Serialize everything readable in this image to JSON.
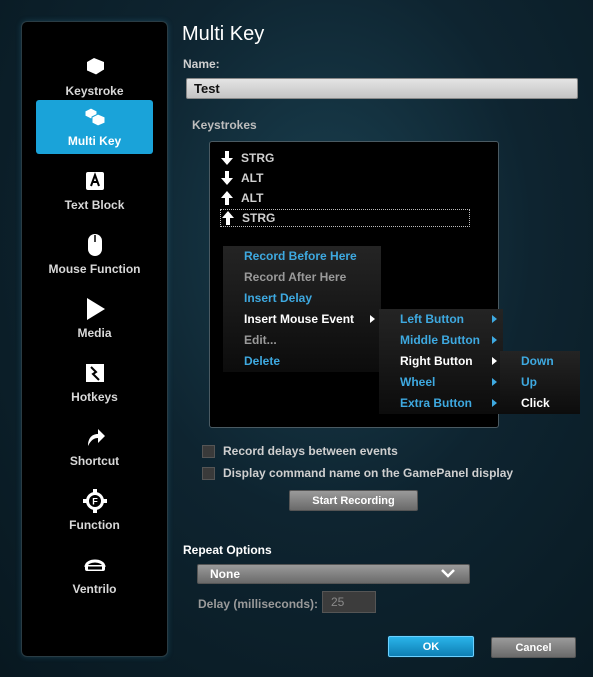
{
  "sidebar": {
    "items": [
      {
        "label": "Keystroke",
        "icon": "keycap-icon"
      },
      {
        "label": "Multi Key",
        "icon": "multi-keycap-icon",
        "active": true
      },
      {
        "label": "Text Block",
        "icon": "letter-a-icon"
      },
      {
        "label": "Mouse Function",
        "icon": "mouse-icon"
      },
      {
        "label": "Media",
        "icon": "play-icon"
      },
      {
        "label": "Hotkeys",
        "icon": "hotkey-icon"
      },
      {
        "label": "Shortcut",
        "icon": "shortcut-arrow-icon"
      },
      {
        "label": "Function",
        "icon": "function-gear-icon"
      },
      {
        "label": "Ventrilo",
        "icon": "ventrilo-headset-icon"
      }
    ]
  },
  "main": {
    "title": "Multi Key",
    "name_label": "Name:",
    "name_value": "Test",
    "keystrokes_label": "Keystrokes",
    "keystrokes": [
      {
        "direction": "down",
        "key": "STRG"
      },
      {
        "direction": "down",
        "key": "ALT"
      },
      {
        "direction": "up",
        "key": "ALT"
      },
      {
        "direction": "up",
        "key": "STRG"
      }
    ],
    "record_delays_label": "Record delays between events",
    "record_delays_checked": false,
    "display_command_label": "Display command name on the GamePanel display",
    "display_command_checked": false,
    "start_recording_label": "Start Recording",
    "repeat_options_label": "Repeat Options",
    "repeat_select_value": "None",
    "delay_label": "Delay (milliseconds):",
    "delay_value": "25",
    "ok_label": "OK",
    "cancel_label": "Cancel"
  },
  "context_menu": {
    "items": [
      {
        "label": "Record Before Here"
      },
      {
        "label": "Record After Here"
      },
      {
        "label": "Insert Delay"
      },
      {
        "label": "Insert Mouse Event"
      },
      {
        "label": "Edit..."
      },
      {
        "label": "Delete"
      }
    ]
  },
  "mouse_submenu": {
    "items": [
      {
        "label": "Left Button"
      },
      {
        "label": "Middle Button"
      },
      {
        "label": "Right Button"
      },
      {
        "label": "Wheel"
      },
      {
        "label": "Extra Button"
      }
    ]
  },
  "button_submenu": {
    "items": [
      {
        "label": "Down"
      },
      {
        "label": "Up"
      },
      {
        "label": "Click"
      }
    ]
  },
  "colors": {
    "accent": "#1aa3d9",
    "menu_blue": "#3ea9e0",
    "background": "#0e2430"
  }
}
